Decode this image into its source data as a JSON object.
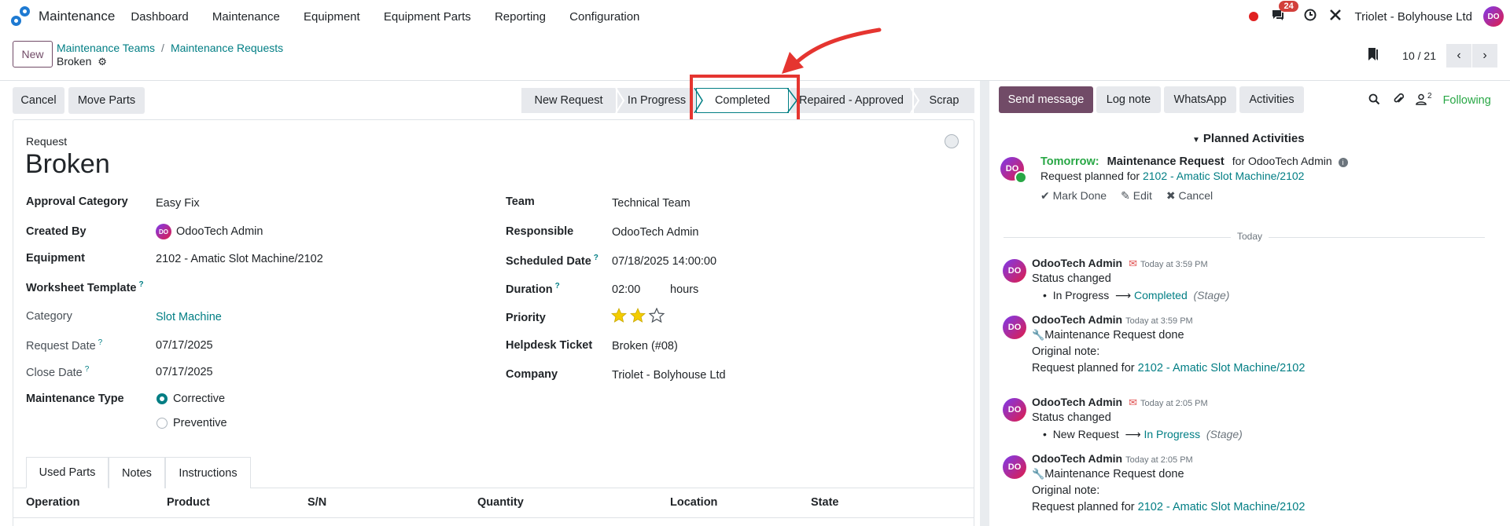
{
  "navbar": {
    "app_name": "Maintenance",
    "menu": [
      "Dashboard",
      "Maintenance",
      "Equipment",
      "Equipment Parts",
      "Reporting",
      "Configuration"
    ],
    "chat_badge": "24",
    "company": "Triolet - Bolyhouse Ltd",
    "avatar": "DO"
  },
  "control": {
    "new_label": "New",
    "breadcrumb": [
      "Maintenance Teams",
      "Maintenance Requests"
    ],
    "record_name": "Broken",
    "pager": "10 / 21"
  },
  "actions": {
    "cancel": "Cancel",
    "move_parts": "Move Parts"
  },
  "stages": [
    "New Request",
    "In Progress",
    "Completed",
    "Repaired - Approved",
    "Scrap"
  ],
  "active_stage": "Completed",
  "form": {
    "request_label": "Request",
    "title": "Broken",
    "left": {
      "approval_category_label": "Approval Category",
      "approval_category": "Easy Fix",
      "created_by_label": "Created By",
      "created_by": "OdooTech Admin",
      "equipment_label": "Equipment",
      "equipment": "2102 - Amatic Slot Machine/2102",
      "worksheet_label": "Worksheet Template",
      "category_label": "Category",
      "category": "Slot Machine",
      "request_date_label": "Request Date",
      "request_date": "07/17/2025",
      "close_date_label": "Close Date",
      "close_date": "07/17/2025",
      "maintenance_type_label": "Maintenance Type",
      "type_corrective": "Corrective",
      "type_preventive": "Preventive"
    },
    "right": {
      "team_label": "Team",
      "team": "Technical Team",
      "responsible_label": "Responsible",
      "responsible": "OdooTech Admin",
      "scheduled_label": "Scheduled Date",
      "scheduled": "07/18/2025 14:00:00",
      "duration_label": "Duration",
      "duration": "02:00",
      "duration_unit": "hours",
      "priority_label": "Priority",
      "priority_stars": 2,
      "helpdesk_label": "Helpdesk Ticket",
      "helpdesk": "Broken (#08)",
      "company_label": "Company",
      "company": "Triolet - Bolyhouse Ltd"
    },
    "tabs": [
      "Used Parts",
      "Notes",
      "Instructions"
    ],
    "columns": [
      "Operation",
      "Product",
      "S/N",
      "Quantity",
      "Location",
      "State"
    ]
  },
  "chatter": {
    "send_message": "Send message",
    "log_note": "Log note",
    "whatsapp": "WhatsApp",
    "activities": "Activities",
    "followers_count": "2",
    "following": "Following",
    "planned_activities": "Planned Activities",
    "activity": {
      "when": "Tomorrow:",
      "title": "Maintenance Request",
      "for": "for OdooTech Admin",
      "planned_prefix": "Request planned for",
      "planned_link": "2102 - Amatic Slot Machine/2102",
      "mark_done": "Mark Done",
      "edit": "Edit",
      "cancel": "Cancel"
    },
    "today": "Today",
    "messages": [
      {
        "author": "OdooTech Admin",
        "time": "Today at 3:59 PM",
        "line1": "Status changed",
        "from": "In Progress",
        "to": "Completed",
        "tag": "(Stage)"
      },
      {
        "author": "OdooTech Admin",
        "time": "Today at 3:59 PM",
        "line1": "Maintenance Request done",
        "line2": "Original note:",
        "line3_prefix": "Request planned for",
        "line3_link": "2102 - Amatic Slot Machine/2102"
      },
      {
        "author": "OdooTech Admin",
        "time": "Today at 2:05 PM",
        "line1": "Status changed",
        "from": "New Request",
        "to": "In Progress",
        "tag": "(Stage)"
      },
      {
        "author": "OdooTech Admin",
        "time": "Today at 2:05 PM",
        "line1": "Maintenance Request done",
        "line2": "Original note:",
        "line3_prefix": "Request planned for",
        "line3_link": "2102 - Amatic Slot Machine/2102"
      }
    ]
  }
}
